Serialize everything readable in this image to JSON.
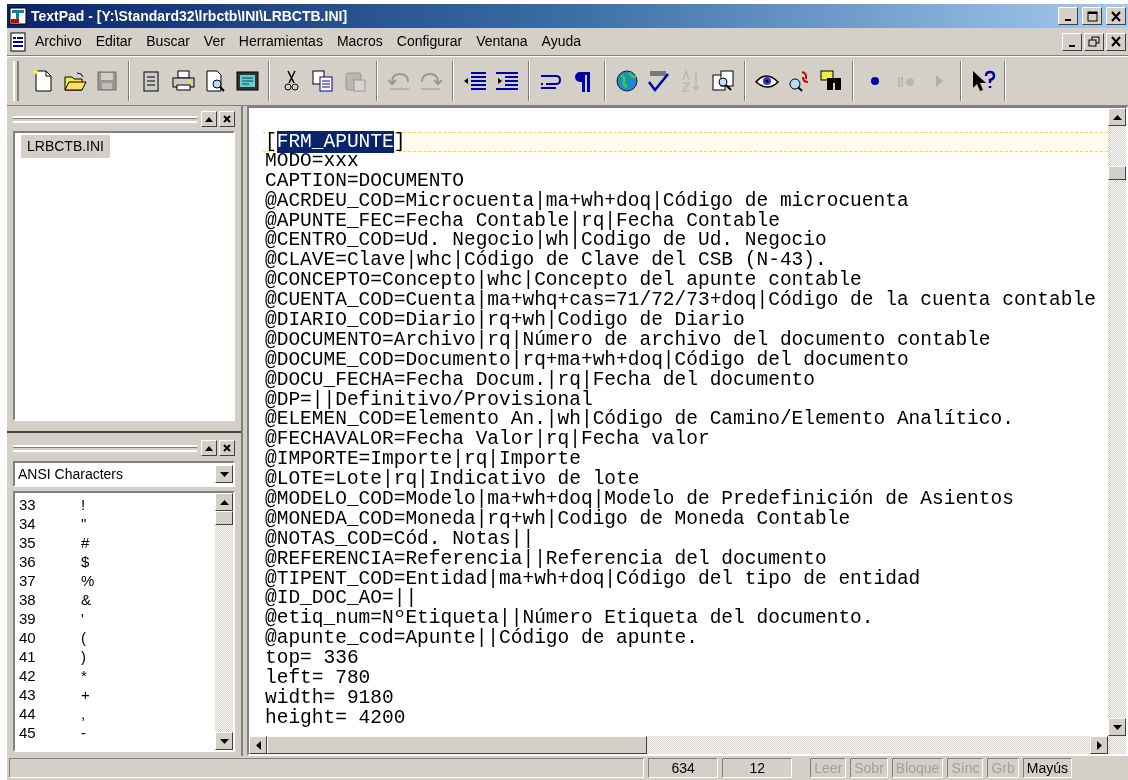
{
  "window": {
    "title": "TextPad - [Y:\\Standard32\\lrbctb\\INI\\LRBCTB.INI]"
  },
  "menu": [
    "Archivo",
    "Editar",
    "Buscar",
    "Ver",
    "Herramientas",
    "Macros",
    "Configurar",
    "Ventana",
    "Ayuda"
  ],
  "toolbar": [
    [
      {
        "kind": "new",
        "disabled": false
      },
      {
        "kind": "open",
        "disabled": false
      },
      {
        "kind": "save",
        "disabled": true
      }
    ],
    [
      {
        "kind": "documents",
        "disabled": false
      },
      {
        "kind": "print",
        "disabled": false
      },
      {
        "kind": "preview",
        "disabled": false
      },
      {
        "kind": "window",
        "disabled": false
      }
    ],
    [
      {
        "kind": "cut",
        "disabled": false
      },
      {
        "kind": "copy",
        "disabled": false
      },
      {
        "kind": "paste",
        "disabled": true
      }
    ],
    [
      {
        "kind": "undo",
        "disabled": true
      },
      {
        "kind": "redo",
        "disabled": true
      }
    ],
    [
      {
        "kind": "outdent",
        "disabled": false
      },
      {
        "kind": "indent",
        "disabled": false
      }
    ],
    [
      {
        "kind": "wrap",
        "disabled": false
      },
      {
        "kind": "pilcrow",
        "disabled": false
      }
    ],
    [
      {
        "kind": "globe",
        "disabled": false
      },
      {
        "kind": "spell",
        "disabled": false
      },
      {
        "kind": "sort",
        "disabled": true
      },
      {
        "kind": "compare",
        "disabled": false
      }
    ],
    [
      {
        "kind": "eye",
        "disabled": false
      },
      {
        "kind": "replace",
        "disabled": false
      },
      {
        "kind": "binoculars",
        "disabled": false
      }
    ],
    [
      {
        "kind": "record",
        "disabled": false
      },
      {
        "kind": "pause",
        "disabled": true
      },
      {
        "kind": "play",
        "disabled": true
      }
    ],
    [
      {
        "kind": "help",
        "disabled": false
      }
    ]
  ],
  "documents": [
    {
      "label": "LRBCTB.INI",
      "selected": true
    }
  ],
  "clip_library": {
    "value": "ANSI Characters",
    "items": [
      {
        "code": "33",
        "char": "!"
      },
      {
        "code": "34",
        "char": "\""
      },
      {
        "code": "35",
        "char": "#"
      },
      {
        "code": "36",
        "char": "$"
      },
      {
        "code": "37",
        "char": "%"
      },
      {
        "code": "38",
        "char": "&"
      },
      {
        "code": "39",
        "char": "'"
      },
      {
        "code": "40",
        "char": "("
      },
      {
        "code": "41",
        "char": ")"
      },
      {
        "code": "42",
        "char": "*"
      },
      {
        "code": "43",
        "char": "+"
      },
      {
        "code": "44",
        "char": ","
      },
      {
        "code": "45",
        "char": "-"
      }
    ]
  },
  "editor": {
    "lines": [
      {
        "current": true,
        "segments": [
          {
            "text": "[",
            "selected": false
          },
          {
            "text": "FRM_APUNTE",
            "selected": true
          },
          {
            "text": "]",
            "selected": false
          }
        ]
      },
      {
        "text": "MODO=xxx",
        "current": false
      },
      {
        "text": "CAPTION=DOCUMENTO",
        "current": false
      },
      {
        "text": "@ACRDEU_COD=Microcuenta|ma+wh+doq|Código de microcuenta",
        "current": false
      },
      {
        "text": "@APUNTE_FEC=Fecha Contable|rq|Fecha Contable",
        "current": false
      },
      {
        "text": "@CENTRO_COD=Ud. Negocio|wh|Codigo de Ud. Negocio",
        "current": false
      },
      {
        "text": "@CLAVE=Clave|whc|Código de Clave del CSB (N-43).",
        "current": false
      },
      {
        "text": "@CONCEPTO=Concepto|whc|Concepto del apunte contable",
        "current": false
      },
      {
        "text": "@CUENTA_COD=Cuenta|ma+whq+cas=71/72/73+doq|Código de la cuenta contable",
        "current": false
      },
      {
        "text": "@DIARIO_COD=Diario|rq+wh|Codigo de Diario",
        "current": false
      },
      {
        "text": "@DOCUMENTO=Archivo|rq|Número de archivo del documento contable",
        "current": false
      },
      {
        "text": "@DOCUME_COD=Documento|rq+ma+wh+doq|Código del documento",
        "current": false
      },
      {
        "text": "@DOCU_FECHA=Fecha Docum.|rq|Fecha del documento",
        "current": false
      },
      {
        "text": "@DP=||Definitivo/Provisional",
        "current": false
      },
      {
        "text": "@ELEMEN_COD=Elemento An.|wh|Código de Camino/Elemento Analítico.",
        "current": false
      },
      {
        "text": "@FECHAVALOR=Fecha Valor|rq|Fecha valor",
        "current": false
      },
      {
        "text": "@IMPORTE=Importe|rq|Importe",
        "current": false
      },
      {
        "text": "@LOTE=Lote|rq|Indicativo de lote",
        "current": false
      },
      {
        "text": "@MODELO_COD=Modelo|ma+wh+doq|Modelo de Predefinición de Asientos",
        "current": false
      },
      {
        "text": "@MONEDA_COD=Moneda|rq+wh|Codigo de Moneda Contable",
        "current": false
      },
      {
        "text": "@NOTAS_COD=Cód. Notas||",
        "current": false
      },
      {
        "text": "@REFERENCIA=Referencia||Referencia del documento",
        "current": false
      },
      {
        "text": "@TIPENT_COD=Entidad|ma+wh+doq|Código del tipo de entidad",
        "current": false
      },
      {
        "text": "@ID_DOC_AO=||",
        "current": false
      },
      {
        "text": "@etiq_num=NºEtiqueta||Número Etiqueta del documento.",
        "current": false
      },
      {
        "text": "@apunte_cod=Apunte||Código de apunte.",
        "current": false
      },
      {
        "text": "top= 336",
        "current": false
      },
      {
        "text": "left= 780",
        "current": false
      },
      {
        "text": "width= 9180",
        "current": false
      },
      {
        "text": "height= 4200",
        "current": false
      }
    ]
  },
  "status_bar": {
    "line": "634",
    "column": "12",
    "indicators": [
      {
        "label": "Leer",
        "on": false
      },
      {
        "label": "Sobr",
        "on": false
      },
      {
        "label": "Bloque",
        "on": false
      },
      {
        "label": "Sínc",
        "on": false
      },
      {
        "label": "Grb",
        "on": false
      },
      {
        "label": "Mayús",
        "on": true
      }
    ]
  }
}
